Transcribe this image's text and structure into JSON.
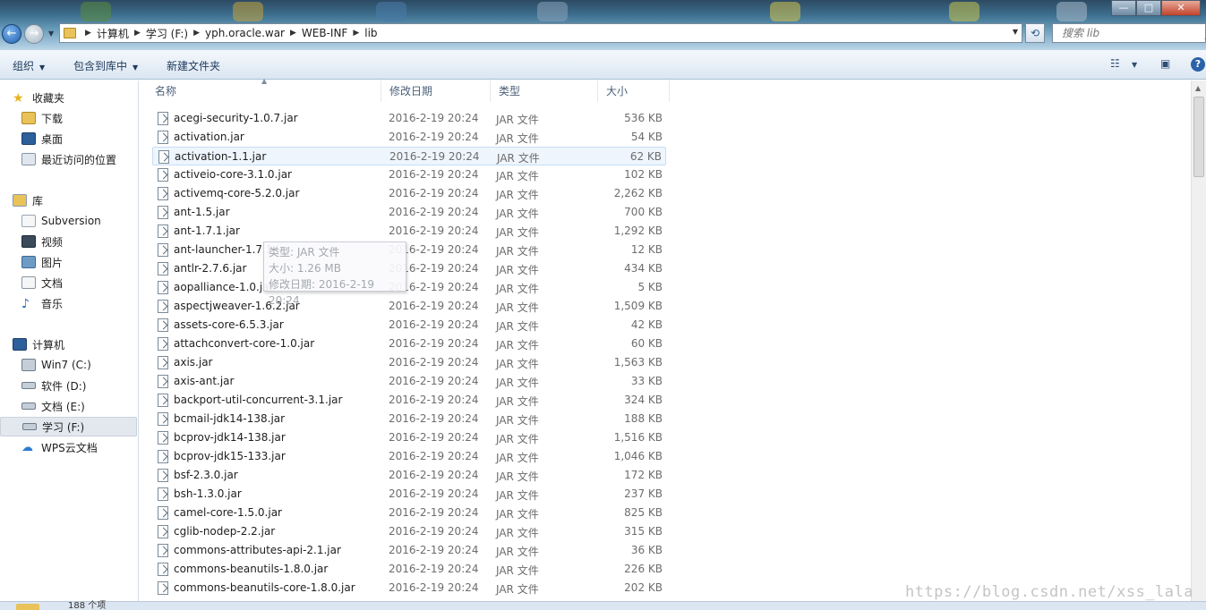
{
  "window": {
    "controls": {
      "minimize": "—",
      "maximize": "□",
      "close": "✕"
    },
    "colors": {
      "titlebar": "#3d6f8e",
      "accent": "#1d5fb0",
      "selection": "#eef5fd"
    }
  },
  "address": {
    "breadcrumbs": [
      "计算机",
      "学习 (F:)",
      "yph.oracle.war",
      "WEB-INF",
      "lib"
    ],
    "search_placeholder": "搜索 lib"
  },
  "toolbar": {
    "organize": "组织",
    "include_library": "包含到库中",
    "new_folder": "新建文件夹"
  },
  "nav": {
    "favorites": {
      "title": "收藏夹",
      "items": [
        "下载",
        "桌面",
        "最近访问的位置"
      ]
    },
    "libraries": {
      "title": "库",
      "items": [
        "Subversion",
        "视频",
        "图片",
        "文档",
        "音乐"
      ]
    },
    "computer": {
      "title": "计算机",
      "items": [
        "Win7 (C:)",
        "软件 (D:)",
        "文档 (E:)",
        "学习 (F:)"
      ]
    },
    "wps": "WPS云文档"
  },
  "columns": {
    "name": "名称",
    "date": "修改日期",
    "type": "类型",
    "size": "大小"
  },
  "files": [
    {
      "name": "acegi-security-1.0.7.jar",
      "date": "2016-2-19 20:24",
      "type": "JAR 文件",
      "size": "536 KB"
    },
    {
      "name": "activation.jar",
      "date": "2016-2-19 20:24",
      "type": "JAR 文件",
      "size": "54 KB"
    },
    {
      "name": "activation-1.1.jar",
      "date": "2016-2-19 20:24",
      "type": "JAR 文件",
      "size": "62 KB"
    },
    {
      "name": "activeio-core-3.1.0.jar",
      "date": "2016-2-19 20:24",
      "type": "JAR 文件",
      "size": "102 KB"
    },
    {
      "name": "activemq-core-5.2.0.jar",
      "date": "2016-2-19 20:24",
      "type": "JAR 文件",
      "size": "2,262 KB"
    },
    {
      "name": "ant-1.5.jar",
      "date": "2016-2-19 20:24",
      "type": "JAR 文件",
      "size": "700 KB"
    },
    {
      "name": "ant-1.7.1.jar",
      "date": "2016-2-19 20:24",
      "type": "JAR 文件",
      "size": "1,292 KB"
    },
    {
      "name": "ant-launcher-1.7.1.jar",
      "date": "2016-2-19 20:24",
      "type": "JAR 文件",
      "size": "12 KB"
    },
    {
      "name": "antlr-2.7.6.jar",
      "date": "2016-2-19 20:24",
      "type": "JAR 文件",
      "size": "434 KB"
    },
    {
      "name": "aopalliance-1.0.jar",
      "date": "2016-2-19 20:24",
      "type": "JAR 文件",
      "size": "5 KB"
    },
    {
      "name": "aspectjweaver-1.6.2.jar",
      "date": "2016-2-19 20:24",
      "type": "JAR 文件",
      "size": "1,509 KB"
    },
    {
      "name": "assets-core-6.5.3.jar",
      "date": "2016-2-19 20:24",
      "type": "JAR 文件",
      "size": "42 KB"
    },
    {
      "name": "attachconvert-core-1.0.jar",
      "date": "2016-2-19 20:24",
      "type": "JAR 文件",
      "size": "60 KB"
    },
    {
      "name": "axis.jar",
      "date": "2016-2-19 20:24",
      "type": "JAR 文件",
      "size": "1,563 KB"
    },
    {
      "name": "axis-ant.jar",
      "date": "2016-2-19 20:24",
      "type": "JAR 文件",
      "size": "33 KB"
    },
    {
      "name": "backport-util-concurrent-3.1.jar",
      "date": "2016-2-19 20:24",
      "type": "JAR 文件",
      "size": "324 KB"
    },
    {
      "name": "bcmail-jdk14-138.jar",
      "date": "2016-2-19 20:24",
      "type": "JAR 文件",
      "size": "188 KB"
    },
    {
      "name": "bcprov-jdk14-138.jar",
      "date": "2016-2-19 20:24",
      "type": "JAR 文件",
      "size": "1,516 KB"
    },
    {
      "name": "bcprov-jdk15-133.jar",
      "date": "2016-2-19 20:24",
      "type": "JAR 文件",
      "size": "1,046 KB"
    },
    {
      "name": "bsf-2.3.0.jar",
      "date": "2016-2-19 20:24",
      "type": "JAR 文件",
      "size": "172 KB"
    },
    {
      "name": "bsh-1.3.0.jar",
      "date": "2016-2-19 20:24",
      "type": "JAR 文件",
      "size": "237 KB"
    },
    {
      "name": "camel-core-1.5.0.jar",
      "date": "2016-2-19 20:24",
      "type": "JAR 文件",
      "size": "825 KB"
    },
    {
      "name": "cglib-nodep-2.2.jar",
      "date": "2016-2-19 20:24",
      "type": "JAR 文件",
      "size": "315 KB"
    },
    {
      "name": "commons-attributes-api-2.1.jar",
      "date": "2016-2-19 20:24",
      "type": "JAR 文件",
      "size": "36 KB"
    },
    {
      "name": "commons-beanutils-1.8.0.jar",
      "date": "2016-2-19 20:24",
      "type": "JAR 文件",
      "size": "226 KB"
    },
    {
      "name": "commons-beanutils-core-1.8.0.jar",
      "date": "2016-2-19 20:24",
      "type": "JAR 文件",
      "size": "202 KB"
    }
  ],
  "tooltip": {
    "type_line": "类型: JAR 文件",
    "size_line": "大小: 1.26 MB",
    "date_line": "修改日期: 2016-2-19 20:24"
  },
  "status": {
    "count": "188 个项"
  },
  "watermark": "https://blog.csdn.net/xss_lala"
}
